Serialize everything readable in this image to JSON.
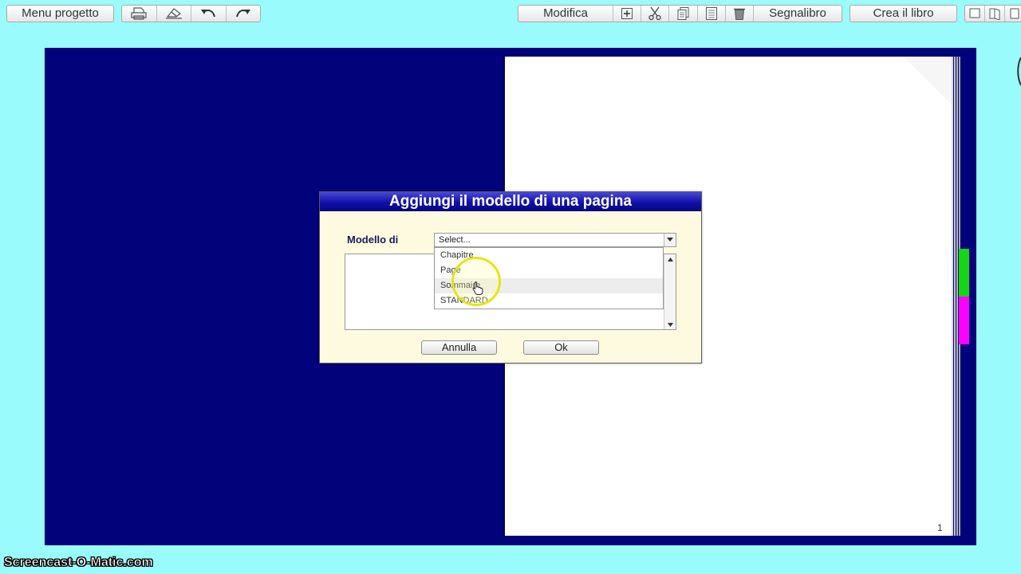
{
  "toolbar": {
    "project_menu_label": "Menu progetto",
    "edit_label": "Modifica",
    "bookmark_label": "Segnalibro",
    "create_book_label": "Crea il libro",
    "icons": [
      "print-icon",
      "eraser-icon",
      "undo-icon",
      "redo-icon",
      "add-icon",
      "cut-icon",
      "copy-icon",
      "paste-icon",
      "trash-icon",
      "single-page-icon",
      "open-book-icon",
      "window-icon"
    ]
  },
  "book": {
    "left_page_color": "#02027a",
    "page_number": "1",
    "tab_colors": [
      "#16d416",
      "#ff00ff"
    ]
  },
  "dialog": {
    "title": "Aggiungi il modello di una pagina",
    "model_label": "Modello di",
    "select_value": "Select...",
    "options": [
      "Chapitre",
      "Page",
      "Sommaire",
      "STANDARD"
    ],
    "hovered_option": "Sommaire",
    "cancel_label": "Annulla",
    "ok_label": "Ok"
  },
  "watermark": "Screencast-O-Matic.com",
  "colors": {
    "background": "#99fbfb",
    "dialog_title": "#1010a8",
    "dialog_body": "#fdfae0"
  }
}
